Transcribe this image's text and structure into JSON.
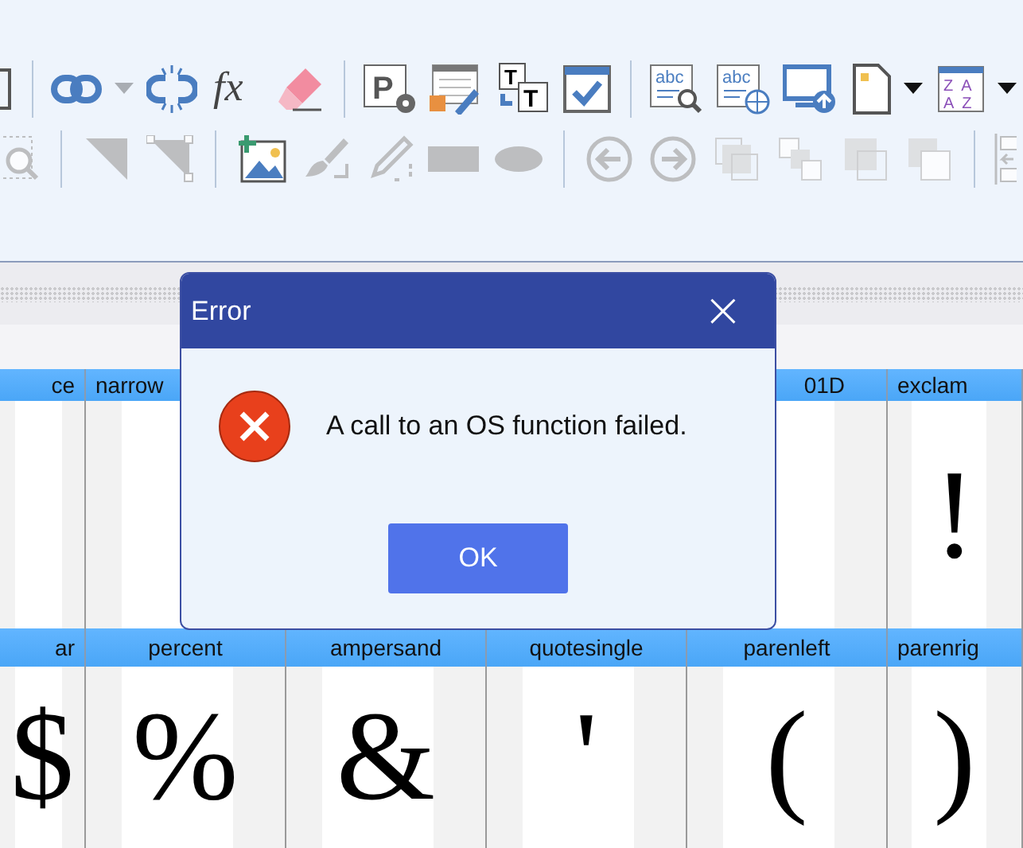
{
  "toolbar": {
    "rows": [
      {
        "groups": [
          {
            "items": [
              {
                "kind": "frame"
              }
            ]
          },
          {
            "items": [
              {
                "kind": "link"
              },
              {
                "kind": "caret-light"
              },
              {
                "kind": "unlink"
              },
              {
                "kind": "formula",
                "labels": [
                  "fx"
                ]
              },
              {
                "kind": "eraser"
              }
            ]
          },
          {
            "items": [
              {
                "kind": "paragraph-settings",
                "labels": [
                  "P"
                ]
              },
              {
                "kind": "table-edit"
              },
              {
                "kind": "text-swap",
                "labels": [
                  "T",
                  "T"
                ]
              },
              {
                "kind": "checkbox-window"
              }
            ]
          },
          {
            "items": [
              {
                "kind": "spell-search",
                "labels": [
                  "abc"
                ]
              },
              {
                "kind": "spell-web",
                "labels": [
                  "abc"
                ]
              },
              {
                "kind": "monitor-upload"
              },
              {
                "kind": "spacer"
              },
              {
                "kind": "page"
              },
              {
                "kind": "caret"
              },
              {
                "kind": "spacer"
              },
              {
                "kind": "sort",
                "labels": [
                  "ZA",
                  "AZ"
                ]
              },
              {
                "kind": "caret"
              }
            ]
          }
        ]
      },
      {
        "groups": [
          {
            "items": [
              {
                "kind": "zoom-box",
                "disabled": true
              }
            ]
          },
          {
            "items": [
              {
                "kind": "triangle",
                "disabled": true
              },
              {
                "kind": "triangle-handles",
                "disabled": true
              }
            ]
          },
          {
            "items": [
              {
                "kind": "image-insert",
                "disabled": false
              },
              {
                "kind": "brush",
                "disabled": true
              },
              {
                "kind": "pencil",
                "disabled": true
              },
              {
                "kind": "rectangle",
                "disabled": true
              },
              {
                "kind": "ellipse",
                "disabled": true
              }
            ]
          },
          {
            "items": [
              {
                "kind": "back",
                "disabled": true
              },
              {
                "kind": "forward",
                "disabled": true
              },
              {
                "kind": "layers-front",
                "disabled": true
              },
              {
                "kind": "layers-back",
                "disabled": true
              },
              {
                "kind": "layer-forward",
                "disabled": true
              },
              {
                "kind": "layer-backward",
                "disabled": true
              }
            ]
          },
          {
            "items": [
              {
                "kind": "align-left",
                "disabled": true
              }
            ]
          }
        ]
      }
    ]
  },
  "glyph_rows": [
    {
      "cells": [
        {
          "label": "ce"
        },
        {
          "label": "narrow"
        },
        {},
        {},
        {
          "label": "01D"
        },
        {
          "label": "exclam",
          "glyph": "!"
        }
      ]
    },
    {
      "cells": [
        {
          "label": "ar",
          "glyph": "$"
        },
        {
          "label": "percent",
          "glyph": "%"
        },
        {
          "label": "ampersand",
          "glyph": "&"
        },
        {
          "label": "quotesingle",
          "glyph": "'"
        },
        {
          "label": "parenleft",
          "glyph": "("
        },
        {
          "label": "parenrig",
          "glyph": ")"
        }
      ]
    }
  ],
  "dialog": {
    "title": "Error",
    "close": "×",
    "message": "A call to an OS function failed.",
    "buttons": [
      "OK"
    ]
  }
}
